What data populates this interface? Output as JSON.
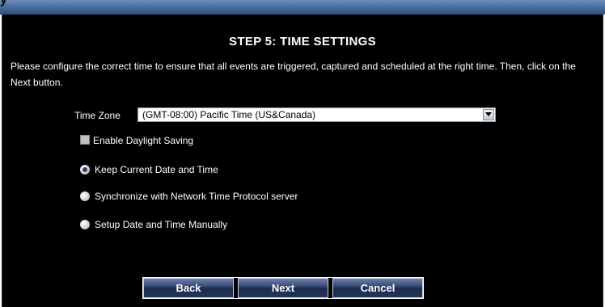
{
  "header": {
    "glyph": "y"
  },
  "step": {
    "title": "STEP 5: TIME SETTINGS",
    "description": "Please configure the correct time to ensure that all events are triggered, captured and scheduled at the right time. Then, click on the Next button."
  },
  "time_zone": {
    "label": "Time Zone",
    "selected": "(GMT-08:00) Pacific Time (US&Canada)"
  },
  "options": {
    "daylight_saving": {
      "label": "Enable Daylight Saving",
      "checked": false
    },
    "keep_current": {
      "label": "Keep Current Date and Time",
      "selected": true
    },
    "ntp": {
      "label": "Synchronize with Network Time Protocol server",
      "selected": false
    },
    "manual": {
      "label": "Setup Date and Time Manually",
      "selected": false
    }
  },
  "buttons": {
    "back": "Back",
    "next": "Next",
    "cancel": "Cancel"
  }
}
